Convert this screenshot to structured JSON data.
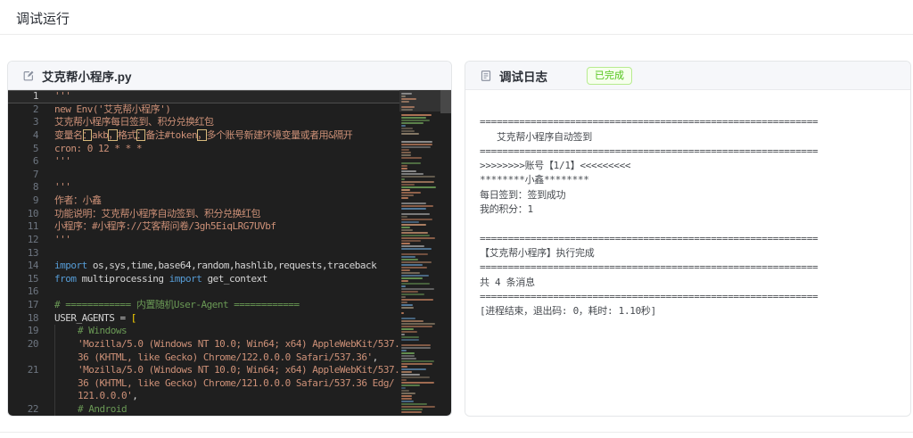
{
  "page": {
    "title": "调试运行"
  },
  "editor_panel": {
    "filename": "艾克帮小程序.py",
    "header_icon": "edit-icon"
  },
  "editor": {
    "rows": [
      {
        "n": "1",
        "cur": true,
        "segs": [
          [
            "str",
            "'''"
          ]
        ]
      },
      {
        "n": "2",
        "segs": [
          [
            "str",
            "new Env('艾克帮小程序')"
          ]
        ]
      },
      {
        "n": "3",
        "segs": [
          [
            "str",
            "艾克帮小程序每日签到、积分兑换红包"
          ]
        ]
      },
      {
        "n": "4",
        "segs": [
          [
            "str",
            "变量名"
          ],
          [
            "box",
            "："
          ],
          [
            "str",
            "akb"
          ],
          [
            "box",
            "，"
          ],
          [
            "str",
            "格式"
          ],
          [
            "box",
            "："
          ],
          [
            "str",
            "备注#token"
          ],
          [
            "box",
            "，"
          ],
          [
            "str",
            "多个账号新建环境变量或者用&隔开"
          ]
        ]
      },
      {
        "n": "5",
        "segs": [
          [
            "str",
            "cron: 0 12 * * *"
          ]
        ]
      },
      {
        "n": "6",
        "segs": [
          [
            "str",
            "'''"
          ]
        ]
      },
      {
        "n": "7",
        "segs": []
      },
      {
        "n": "8",
        "segs": [
          [
            "str",
            "'''"
          ]
        ]
      },
      {
        "n": "9",
        "segs": [
          [
            "str",
            "作者：小鑫"
          ]
        ]
      },
      {
        "n": "10",
        "segs": [
          [
            "str",
            "功能说明：艾克帮小程序自动签到、积分兑换红包"
          ]
        ]
      },
      {
        "n": "11",
        "segs": [
          [
            "str",
            "小程序：#小程序://艾客帮问卷/3gh5EiqLRG7UVbf"
          ]
        ]
      },
      {
        "n": "12",
        "segs": [
          [
            "str",
            "'''"
          ]
        ]
      },
      {
        "n": "13",
        "segs": []
      },
      {
        "n": "14",
        "segs": [
          [
            "kw",
            "import"
          ],
          [
            "pln",
            " os,sys,time,base64,random,hashlib,requests,traceback"
          ]
        ]
      },
      {
        "n": "15",
        "segs": [
          [
            "kw",
            "from"
          ],
          [
            "pln",
            " multiprocessing "
          ],
          [
            "kw",
            "import"
          ],
          [
            "pln",
            " get_context"
          ]
        ]
      },
      {
        "n": "16",
        "segs": []
      },
      {
        "n": "17",
        "segs": [
          [
            "com",
            "# ============ 内置随机User-Agent ============"
          ]
        ]
      },
      {
        "n": "18",
        "segs": [
          [
            "pln",
            "USER_AGENTS = "
          ],
          [
            "brk",
            "["
          ]
        ]
      },
      {
        "n": "19",
        "ind": 4,
        "segs": [
          [
            "com",
            "# Windows"
          ]
        ]
      },
      {
        "n": "20",
        "ind": 4,
        "segs": [
          [
            "str",
            "'Mozilla/5.0 (Windows NT 10.0; Win64; x64) AppleWebKit/537."
          ]
        ]
      },
      {
        "n": "",
        "ind": 4,
        "segs": [
          [
            "str",
            "36 (KHTML, like Gecko) Chrome/122.0.0.0 Safari/537.36'"
          ],
          [
            "pln",
            ","
          ]
        ]
      },
      {
        "n": "21",
        "ind": 4,
        "segs": [
          [
            "str",
            "'Mozilla/5.0 (Windows NT 10.0; Win64; x64) AppleWebKit/537."
          ]
        ]
      },
      {
        "n": "",
        "ind": 4,
        "segs": [
          [
            "str",
            "36 (KHTML, like Gecko) Chrome/121.0.0.0 Safari/537.36 Edg/"
          ]
        ]
      },
      {
        "n": "",
        "ind": 4,
        "segs": [
          [
            "str",
            "121.0.0.0'"
          ],
          [
            "pln",
            ","
          ]
        ]
      },
      {
        "n": "22",
        "ind": 4,
        "segs": [
          [
            "com",
            "# Android"
          ]
        ]
      }
    ]
  },
  "log_panel": {
    "title": "调试日志",
    "header_icon": "document-icon",
    "status_badge": "已完成",
    "lines": [
      "",
      "============================================================",
      "   艾克帮小程序自动签到",
      "============================================================",
      ">>>>>>>>账号【1/1】<<<<<<<<<",
      "********小鑫********",
      "每日签到：签到成功",
      "我的积分：1",
      "",
      "============================================================",
      "【艾克帮小程序】执行完成",
      "============================================================",
      "共 4 条消息",
      "============================================================",
      "[进程结束，退出码: 0，耗时: 1.10秒]"
    ]
  },
  "colors": {
    "status_green": "#52c41a",
    "status_green_bg": "#f6ffed",
    "status_green_border": "#b7eb8f",
    "editor_bg": "#1f1f1f",
    "syntax_string": "#ce9178",
    "syntax_keyword": "#569cd6",
    "syntax_comment": "#6a9955",
    "syntax_plain": "#d4d4d4",
    "syntax_bracket": "#ffd700"
  }
}
